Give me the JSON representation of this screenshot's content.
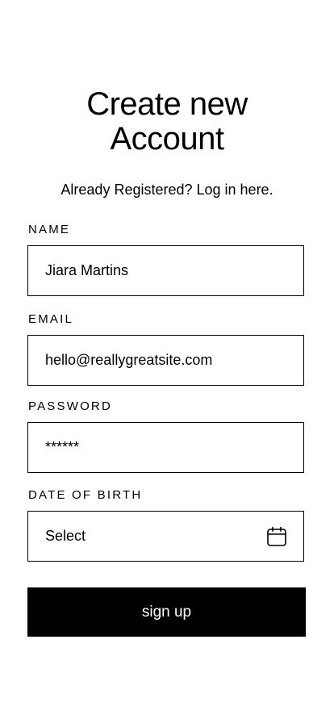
{
  "header": {
    "title_line1": "Create new",
    "title_line2": "Account",
    "login_prompt": "Already Registered? Log in here."
  },
  "form": {
    "name": {
      "label": "NAME",
      "value": "Jiara Martins"
    },
    "email": {
      "label": "EMAIL",
      "value": "hello@reallygreatsite.com"
    },
    "password": {
      "label": "PASSWORD",
      "value": "******"
    },
    "dob": {
      "label": "DATE OF BIRTH",
      "value": "Select",
      "icon": "calendar-icon"
    },
    "submit_label": "sign up"
  }
}
